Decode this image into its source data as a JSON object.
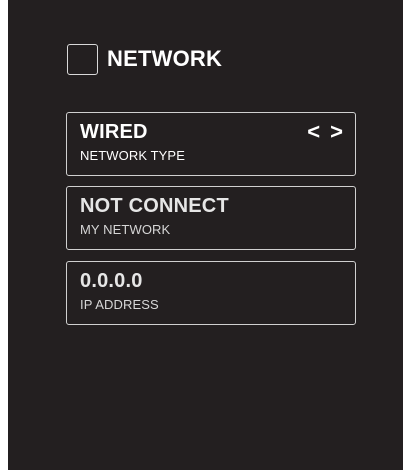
{
  "header": {
    "title": "NETWORK",
    "checkbox_checked": false
  },
  "network_type": {
    "value": "WIRED",
    "label": "NETWORK TYPE",
    "prev_symbol": "<",
    "next_symbol": ">"
  },
  "my_network": {
    "value": "NOT CONNECT",
    "label": "MY NETWORK"
  },
  "ip_address": {
    "value": "0.0.0.0",
    "label": "IP ADDRESS"
  },
  "colors": {
    "background": "#231f20",
    "text": "#ffffff",
    "border": "#d0d0d0"
  }
}
